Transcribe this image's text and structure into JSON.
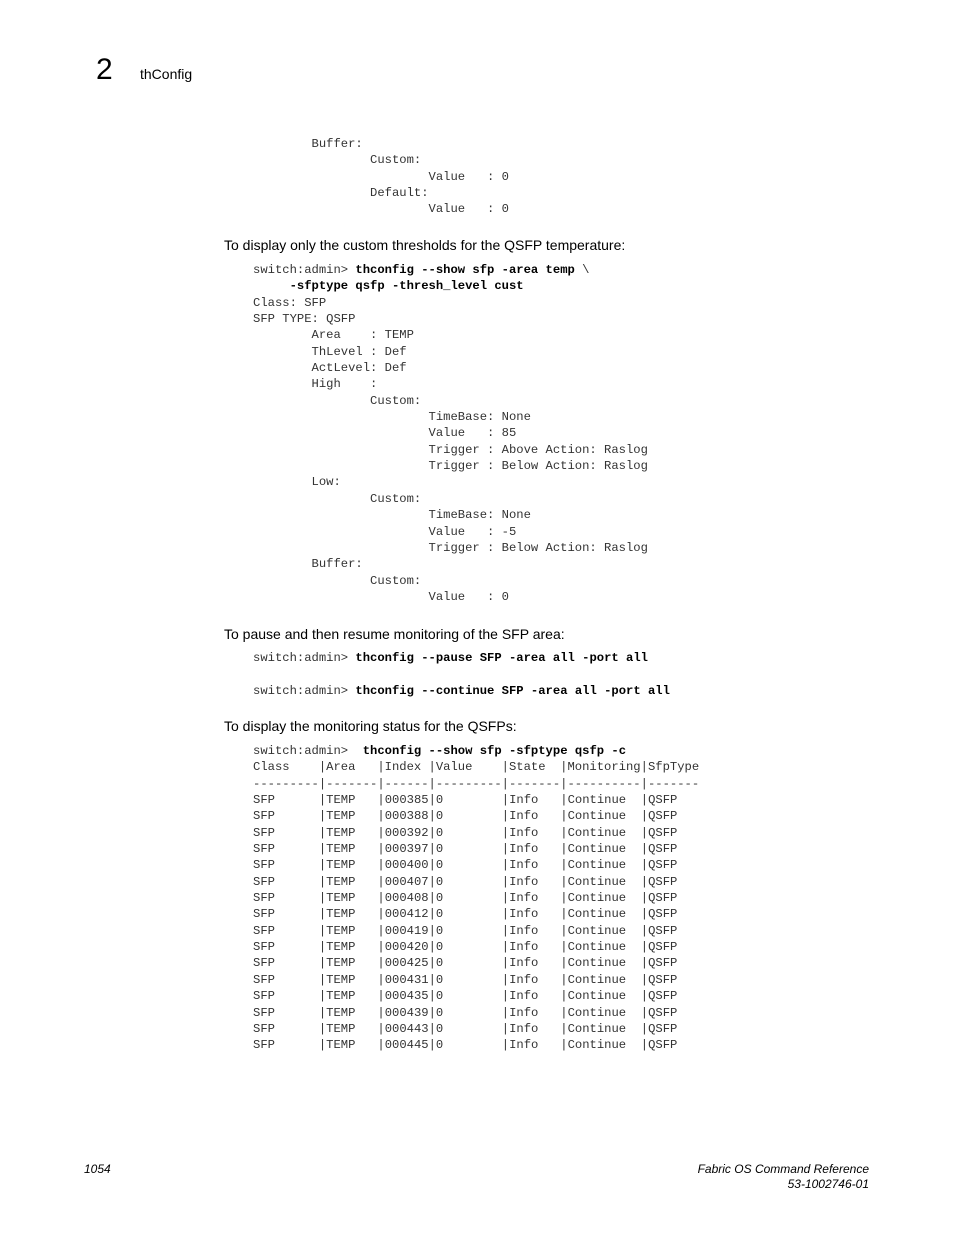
{
  "header": {
    "chapter_number": "2",
    "running_title": "thConfig"
  },
  "blocks": [
    {
      "type": "code",
      "lines": [
        {
          "text": "        Buffer:"
        },
        {
          "text": "                Custom:"
        },
        {
          "text": "                        Value   : 0"
        },
        {
          "text": "                Default:"
        },
        {
          "text": "                        Value   : 0"
        }
      ]
    },
    {
      "type": "para",
      "text": "To display only the custom thresholds for the QSFP temperature:"
    },
    {
      "type": "code",
      "lines": [
        {
          "prompt": "switch:admin> ",
          "cmd": "thconfig --show sfp -area temp ",
          "tail": "\\"
        },
        {
          "prompt": "     ",
          "cmd": "-sfptype qsfp -thresh_level cust"
        },
        {
          "text": "Class: SFP"
        },
        {
          "text": "SFP TYPE: QSFP"
        },
        {
          "text": "        Area    : TEMP"
        },
        {
          "text": "        ThLevel : Def"
        },
        {
          "text": "        ActLevel: Def"
        },
        {
          "text": "        High    :"
        },
        {
          "text": "                Custom:"
        },
        {
          "text": "                        TimeBase: None"
        },
        {
          "text": "                        Value   : 85"
        },
        {
          "text": "                        Trigger : Above Action: Raslog"
        },
        {
          "text": "                        Trigger : Below Action: Raslog"
        },
        {
          "text": "        Low:"
        },
        {
          "text": "                Custom:"
        },
        {
          "text": "                        TimeBase: None"
        },
        {
          "text": "                        Value   : -5"
        },
        {
          "text": "                        Trigger : Below Action: Raslog"
        },
        {
          "text": "        Buffer:"
        },
        {
          "text": "                Custom:"
        },
        {
          "text": "                        Value   : 0"
        }
      ]
    },
    {
      "type": "para",
      "text": "To pause and then resume monitoring of the SFP area:"
    },
    {
      "type": "code",
      "lines": [
        {
          "prompt": "switch:admin> ",
          "cmd": "thconfig --pause SFP -area all -port all"
        },
        {
          "text": ""
        },
        {
          "prompt": "switch:admin> ",
          "cmd": "thconfig --continue SFP -area all -port all"
        }
      ]
    },
    {
      "type": "para",
      "text": "To display the monitoring status for the QSFPs:"
    },
    {
      "type": "code",
      "lines": [
        {
          "prompt": "switch:admin>  ",
          "cmd": "thconfig --show sfp -sfptype qsfp -c"
        }
      ]
    }
  ],
  "status_table": {
    "columns": [
      "Class",
      "Area",
      "Index",
      "Value",
      "State",
      "Monitoring",
      "SfpType"
    ],
    "header_line": "Class    |Area   |Index |Value    |State  |Monitoring|SfpType",
    "separator_line": "---------|-------|------|---------|-------|----------|-------",
    "rows": [
      [
        "SFP",
        "TEMP",
        "000385",
        "0",
        "Info",
        "Continue",
        "QSFP"
      ],
      [
        "SFP",
        "TEMP",
        "000388",
        "0",
        "Info",
        "Continue",
        "QSFP"
      ],
      [
        "SFP",
        "TEMP",
        "000392",
        "0",
        "Info",
        "Continue",
        "QSFP"
      ],
      [
        "SFP",
        "TEMP",
        "000397",
        "0",
        "Info",
        "Continue",
        "QSFP"
      ],
      [
        "SFP",
        "TEMP",
        "000400",
        "0",
        "Info",
        "Continue",
        "QSFP"
      ],
      [
        "SFP",
        "TEMP",
        "000407",
        "0",
        "Info",
        "Continue",
        "QSFP"
      ],
      [
        "SFP",
        "TEMP",
        "000408",
        "0",
        "Info",
        "Continue",
        "QSFP"
      ],
      [
        "SFP",
        "TEMP",
        "000412",
        "0",
        "Info",
        "Continue",
        "QSFP"
      ],
      [
        "SFP",
        "TEMP",
        "000419",
        "0",
        "Info",
        "Continue",
        "QSFP"
      ],
      [
        "SFP",
        "TEMP",
        "000420",
        "0",
        "Info",
        "Continue",
        "QSFP"
      ],
      [
        "SFP",
        "TEMP",
        "000425",
        "0",
        "Info",
        "Continue",
        "QSFP"
      ],
      [
        "SFP",
        "TEMP",
        "000431",
        "0",
        "Info",
        "Continue",
        "QSFP"
      ],
      [
        "SFP",
        "TEMP",
        "000435",
        "0",
        "Info",
        "Continue",
        "QSFP"
      ],
      [
        "SFP",
        "TEMP",
        "000439",
        "0",
        "Info",
        "Continue",
        "QSFP"
      ],
      [
        "SFP",
        "TEMP",
        "000443",
        "0",
        "Info",
        "Continue",
        "QSFP"
      ],
      [
        "SFP",
        "TEMP",
        "000445",
        "0",
        "Info",
        "Continue",
        "QSFP"
      ]
    ]
  },
  "footer": {
    "page_number": "1054",
    "doc_title": "Fabric OS Command Reference",
    "doc_number": "53-1002746-01"
  }
}
